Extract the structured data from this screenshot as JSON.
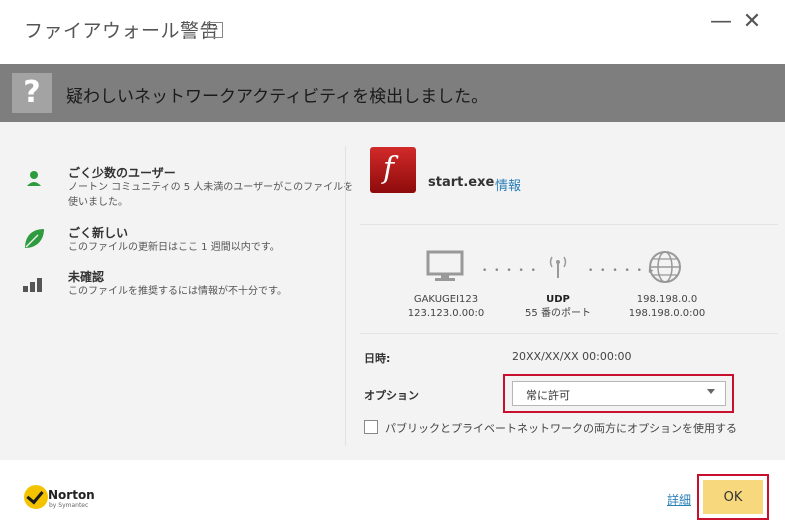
{
  "window": {
    "title": "ファイアウォール警告",
    "help_label": "?",
    "minimize_glyph": "—",
    "close_glyph": "✕"
  },
  "banner": {
    "icon_glyph": "?",
    "message": "疑わしいネットワークアクティビティを検出しました。"
  },
  "info": [
    {
      "icon": "user-icon",
      "title": "ごく少数のユーザー",
      "description": "ノートン コミュニティの 5 人未満のユーザーがこのファイルを使いました。"
    },
    {
      "icon": "leaf-icon",
      "title": "ごく新しい",
      "description": "このファイルの更新日はここ 1 週間以内です。"
    },
    {
      "icon": "signal-bars-icon",
      "title": "未確認",
      "description": "このファイルを推奨するには情報が不十分です。"
    }
  ],
  "app": {
    "icon": "flash-app-icon",
    "icon_glyph": "f",
    "name": "start.exe",
    "info_link": "情報"
  },
  "network": {
    "local": {
      "icon": "monitor-icon",
      "name": "GAKUGEI123",
      "address": "123.123.0.00:0"
    },
    "protocol": {
      "icon": "antenna-icon",
      "name": "UDP",
      "port": "55 番のポート"
    },
    "remote": {
      "icon": "globe-icon",
      "address": "198.198.0.0",
      "address2": "198.198.0.0:00"
    },
    "dots_left": "• • • • •",
    "dots_right": "• • • • • ▸"
  },
  "details": {
    "date_label": "日時:",
    "date_value": "20XX/XX/XX 00:00:00",
    "option_label": "オプション",
    "option_selected": "常に許可",
    "checkbox_label": "パブリックとプライベートネットワークの両方にオプションを使用する"
  },
  "footer": {
    "brand": "Norton",
    "brand_sub": "by Symantec",
    "detail_link": "詳細",
    "ok_label": "OK"
  },
  "colors": {
    "banner_bg": "#7e7e7e",
    "content_bg": "#f3f3f3",
    "link": "#2a7fb8",
    "highlight": "#c8102e",
    "ok_button": "#f8d87c",
    "green_icon": "#2e9b3e"
  }
}
